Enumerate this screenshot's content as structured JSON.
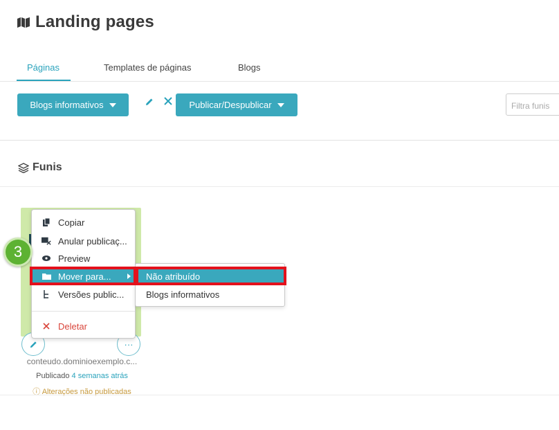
{
  "header": {
    "title": "Landing pages",
    "icon": "map-icon"
  },
  "tabs": [
    {
      "label": "Páginas",
      "active": true
    },
    {
      "label": "Templates de páginas",
      "active": false
    },
    {
      "label": "Blogs",
      "active": false
    }
  ],
  "toolbar": {
    "dropdown_label": "Blogs informativos",
    "publish_label": "Publicar/Despublicar",
    "filter_placeholder": "Filtra funis"
  },
  "section": {
    "title": "Funis",
    "icon": "layers-icon"
  },
  "card": {
    "url": "conteudo.dominioexemplo.c...",
    "status_prefix": "Publicado",
    "status_time": "4 semanas atrás",
    "warning": "Alterações não publicadas"
  },
  "menu": {
    "items": [
      {
        "label": "Copiar",
        "icon": "copy-icon"
      },
      {
        "label": "Anular publicaç...",
        "icon": "unpublish-icon"
      },
      {
        "label": "Preview",
        "icon": "eye-icon"
      },
      {
        "label": "Mover para...",
        "icon": "folder-icon"
      },
      {
        "label": "Versões public...",
        "icon": "versions-icon"
      },
      {
        "label": "Deletar",
        "icon": "close-icon"
      }
    ]
  },
  "submenu": {
    "items": [
      {
        "label": "Não atribuído"
      },
      {
        "label": "Blogs informativos"
      }
    ]
  },
  "step_badge": "3",
  "colors": {
    "accent": "#3aa8bd",
    "danger": "#d9453b",
    "highlight": "#e3111c",
    "badge": "#5db233"
  }
}
